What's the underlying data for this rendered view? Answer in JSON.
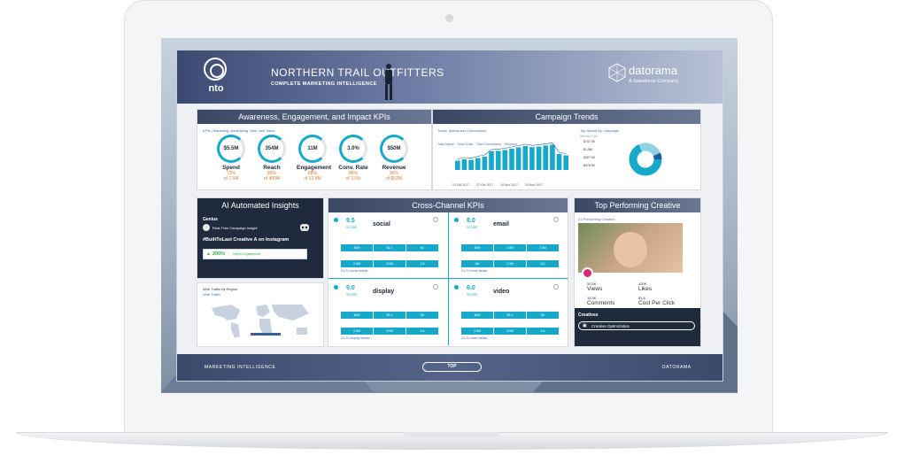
{
  "header": {
    "logo_text": "nto",
    "title": "NORTHERN TRAIL OUTFITTERS",
    "subtitle": "COMPLETE MARKETING INTELLIGENCE",
    "partner_name": "datorama",
    "partner_sub": "A Salesforce Company"
  },
  "kpis": {
    "title": "Awareness, Engagement, and Impact KPIs",
    "subtitle": "KPIs | Marketing, Advertising, Web, and Sales",
    "items": [
      {
        "value": "$5.5M",
        "name": "Spend",
        "pct": "73%",
        "of": "of 7.5M"
      },
      {
        "value": "354M",
        "name": "Reach",
        "pct": "89%",
        "of": "of 400M"
      },
      {
        "value": "11M",
        "name": "Engagement",
        "pct": "88%",
        "of": "of 12.5M"
      },
      {
        "value": "3.0%",
        "name": "Conv. Rate",
        "pct": "86%",
        "of": "of 3.5%"
      },
      {
        "value": "$50M",
        "name": "Revenue",
        "pct": "96%",
        "of": "of $52M"
      }
    ]
  },
  "campaign": {
    "title": "Campaign Trends",
    "trend_label": "Trend: Spend and Conversions",
    "tabs": [
      "Total Spend",
      "Total Clicks",
      "Total Conversions",
      "Revenue"
    ],
    "dates": [
      "13 Oct 2017",
      "27 Oct 2017",
      "10 Nov 2017",
      "24 Nov 2017"
    ],
    "top_spend_label": "Top Spend By Campaign",
    "media_cost": "Media Cost",
    "pie_labels": [
      "$747.0K",
      "$1.0M",
      "$307.0K",
      "$478.5K"
    ],
    "bars": [
      0.35,
      0.4,
      0.38,
      0.45,
      0.5,
      0.7,
      0.72,
      0.75,
      0.8,
      0.85,
      0.9,
      0.86,
      0.88,
      0.92,
      0.95,
      0.6,
      0.55
    ]
  },
  "ai": {
    "title": "AI Automated Insights",
    "genius": "Genius",
    "insight_title": "Real-Time Campaign Insight",
    "headline": "#BuiltToLast Creative A on Instagram",
    "stat": "200%",
    "stat_label": "Higher Engagement"
  },
  "map": {
    "title": "Web Traffic by Region",
    "sub": "Web Traffic"
  },
  "cross": {
    "title": "Cross-Channel KPIs",
    "channels": [
      {
        "num": "9.5",
        "sub": "SCORE",
        "name": "social",
        "cells": [
          "$4M",
          "$2.1",
          "$4",
          "2.5M",
          "4.5M",
          "4.5"
        ],
        "link": "Go To social details"
      },
      {
        "num": "8.0",
        "sub": "SCORE",
        "name": "email",
        "cells": [
          "$4M",
          "4.5M",
          "2.5M",
          "6M",
          "2.3M",
          "8.0"
        ],
        "link": "Go To email details"
      },
      {
        "num": "9.0",
        "sub": "SCORE",
        "name": "display",
        "cells": [
          "$4M",
          "$2.1",
          "$4",
          "2.5M",
          "4.5M",
          "4.5"
        ],
        "link": "Go To display details"
      },
      {
        "num": "6.0",
        "sub": "SCORE",
        "name": "video",
        "cells": [
          "$4M",
          "$2.1",
          "$4",
          "2.5M",
          "4.5M",
          "4.5"
        ],
        "link": "Go To video details"
      }
    ]
  },
  "creative": {
    "title": "Top Performing Creative",
    "label": "#1 Performing Creative",
    "stats": [
      {
        "value": "50.5K",
        "label": "Views"
      },
      {
        "value": "420K",
        "label": "Likes"
      },
      {
        "value": "14.5K",
        "label": "Comments"
      },
      {
        "value": "$1.8",
        "label": "Cost Per Click"
      }
    ],
    "section": "Creatives",
    "button": "Creative Optimization"
  },
  "footer": {
    "left": "MARKETING INTELLIGENCE",
    "button": "TOP",
    "right": "DATORAMA"
  }
}
